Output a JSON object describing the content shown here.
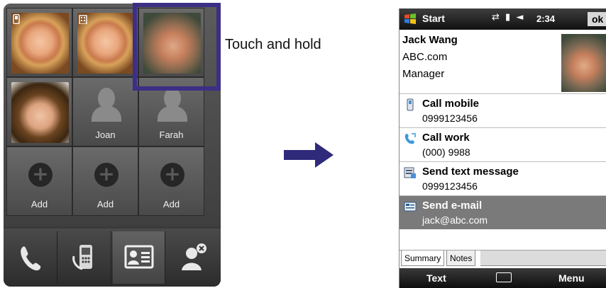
{
  "callout": "Touch and hold",
  "left_phone": {
    "tiles": [
      {
        "name": "",
        "icon": "mobile-phone-icon"
      },
      {
        "name": "",
        "icon": "building-icon"
      },
      {
        "name": "",
        "icon": ""
      },
      {
        "name": "",
        "icon": ""
      },
      {
        "name": "Joan",
        "icon": "person-silhouette-icon"
      },
      {
        "name": "Farah",
        "icon": "person-silhouette-icon"
      },
      {
        "name": "Add",
        "icon": "plus-icon"
      },
      {
        "name": "Add",
        "icon": "plus-icon"
      },
      {
        "name": "Add",
        "icon": "plus-icon"
      }
    ],
    "highlight_color": "#3b2f86",
    "dock": [
      "phone-icon",
      "dialer-phone-icon",
      "contact-card-icon",
      "remove-contact-icon"
    ]
  },
  "right_phone": {
    "title": "Start",
    "time": "2:34",
    "ok": "ok",
    "contact": {
      "name": "Jack Wang",
      "company": "ABC.com",
      "job_title": "Manager"
    },
    "actions": [
      {
        "label": "Call mobile",
        "value": "0999123456",
        "icon": "mobile-phone-icon"
      },
      {
        "label": "Call work",
        "value": "(000) 9988",
        "icon": "work-phone-icon"
      },
      {
        "label": "Send text message",
        "value": "0999123456",
        "icon": "sms-icon"
      },
      {
        "label": "Send e-mail",
        "value": "jack@abc.com",
        "icon": "email-icon"
      }
    ],
    "tabs": [
      "Summary",
      "Notes"
    ],
    "softkeys": {
      "left": "Text",
      "right": "Menu"
    },
    "selected_color": "#7a7a7a"
  }
}
